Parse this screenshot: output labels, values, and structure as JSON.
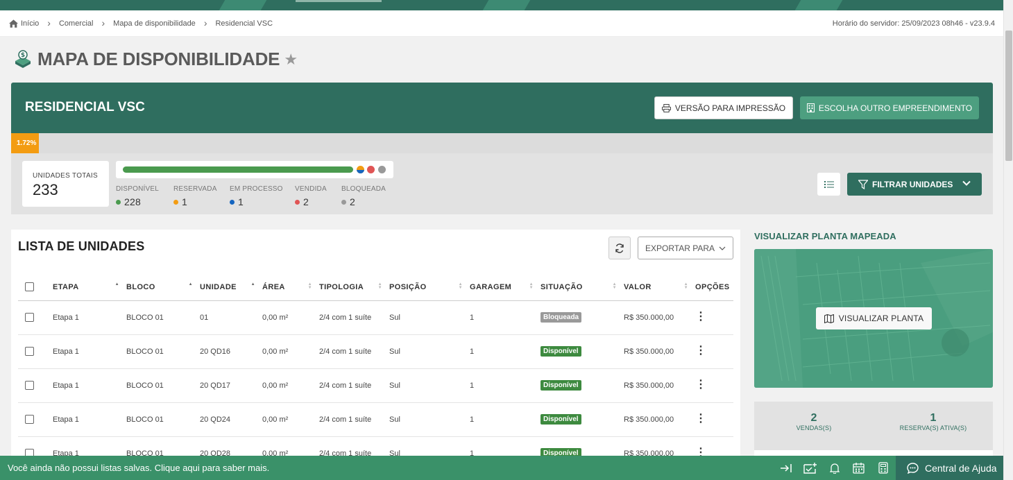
{
  "breadcrumb": {
    "items": [
      "Início",
      "Comercial",
      "Mapa de disponibilidade",
      "Residencial VSC"
    ],
    "server_time": "Horário do servidor: 25/09/2023 08h46 - v23.9.4"
  },
  "page": {
    "title": "MAPA DE DISPONIBILIDADE"
  },
  "hero": {
    "title": "RESIDENCIAL VSC",
    "print_label": "VERSÃO PARA IMPRESSÃO",
    "other_label": "ESCOLHA OUTRO EMPREENDIMENTO"
  },
  "progress": {
    "label": "1.72%",
    "percent": 1.72,
    "color": "#f39c12"
  },
  "stats": {
    "total_label": "UNIDADES TOTAIS",
    "total_value": "233",
    "legend": [
      {
        "label": "DISPONÍVEL",
        "value": "228",
        "color": "#4a9a4e"
      },
      {
        "label": "RESERVADA",
        "value": "1",
        "color": "#f39c12"
      },
      {
        "label": "EM PROCESSO",
        "value": "1",
        "color": "#1565c0"
      },
      {
        "label": "VENDIDA",
        "value": "2",
        "color": "#e05555"
      },
      {
        "label": "BLOQUEADA",
        "value": "2",
        "color": "#999999"
      }
    ],
    "filter_label": "FILTRAR UNIDADES"
  },
  "list": {
    "title": "LISTA DE UNIDADES",
    "export_label": "EXPORTAR PARA",
    "columns": [
      "ETAPA",
      "BLOCO",
      "UNIDADE",
      "ÁREA",
      "TIPOLOGIA",
      "POSIÇÃO",
      "GARAGEM",
      "SITUAÇÃO",
      "VALOR",
      "OPÇÕES"
    ],
    "rows": [
      {
        "etapa": "Etapa 1",
        "bloco": "BLOCO 01",
        "unidade": "01",
        "area": "0,00 m²",
        "tipologia": "2/4 com 1 suíte",
        "posicao": "Sul",
        "garagem": "1",
        "situacao": "Bloqueada",
        "valor": "R$ 350.000,00"
      },
      {
        "etapa": "Etapa 1",
        "bloco": "BLOCO 01",
        "unidade": "20 QD16",
        "area": "0,00 m²",
        "tipologia": "2/4 com 1 suíte",
        "posicao": "Sul",
        "garagem": "1",
        "situacao": "Disponível",
        "valor": "R$ 350.000,00"
      },
      {
        "etapa": "Etapa 1",
        "bloco": "BLOCO 01",
        "unidade": "20 QD17",
        "area": "0,00 m²",
        "tipologia": "2/4 com 1 suíte",
        "posicao": "Sul",
        "garagem": "1",
        "situacao": "Disponível",
        "valor": "R$ 350.000,00"
      },
      {
        "etapa": "Etapa 1",
        "bloco": "BLOCO 01",
        "unidade": "20 QD24",
        "area": "0,00 m²",
        "tipologia": "2/4 com 1 suíte",
        "posicao": "Sul",
        "garagem": "1",
        "situacao": "Disponível",
        "valor": "R$ 350.000,00"
      },
      {
        "etapa": "Etapa 1",
        "bloco": "BLOCO 01",
        "unidade": "20 QD28",
        "area": "0,00 m²",
        "tipologia": "2/4 com 1 suíte",
        "posicao": "Sul",
        "garagem": "1",
        "situacao": "Disponível",
        "valor": "R$ 350.000,00"
      }
    ],
    "status_colors": {
      "Bloqueada": "#999999",
      "Disponível": "#3d8a3f"
    }
  },
  "map": {
    "title": "VISUALIZAR PLANTA MAPEADA",
    "button_label": "VISUALIZAR PLANTA"
  },
  "counts": [
    {
      "value": "2",
      "label": "VENDAS(S)"
    },
    {
      "value": "1",
      "label": "RESERVA(S) ATIVA(S)"
    }
  ],
  "footer": {
    "message": "Você ainda não possui listas salvas. Clique aqui para saber mais.",
    "help_label": "Central de Ajuda"
  },
  "icons": [
    "home-icon",
    "chevron-right-icon",
    "logo-icon",
    "star-icon",
    "printer-icon",
    "building-icon",
    "list-icon",
    "filter-icon",
    "chevron-down-icon",
    "refresh-icon",
    "map-icon",
    "login-icon",
    "add-list-icon",
    "bell-icon",
    "calendar-icon",
    "calculator-icon",
    "chat-icon"
  ]
}
